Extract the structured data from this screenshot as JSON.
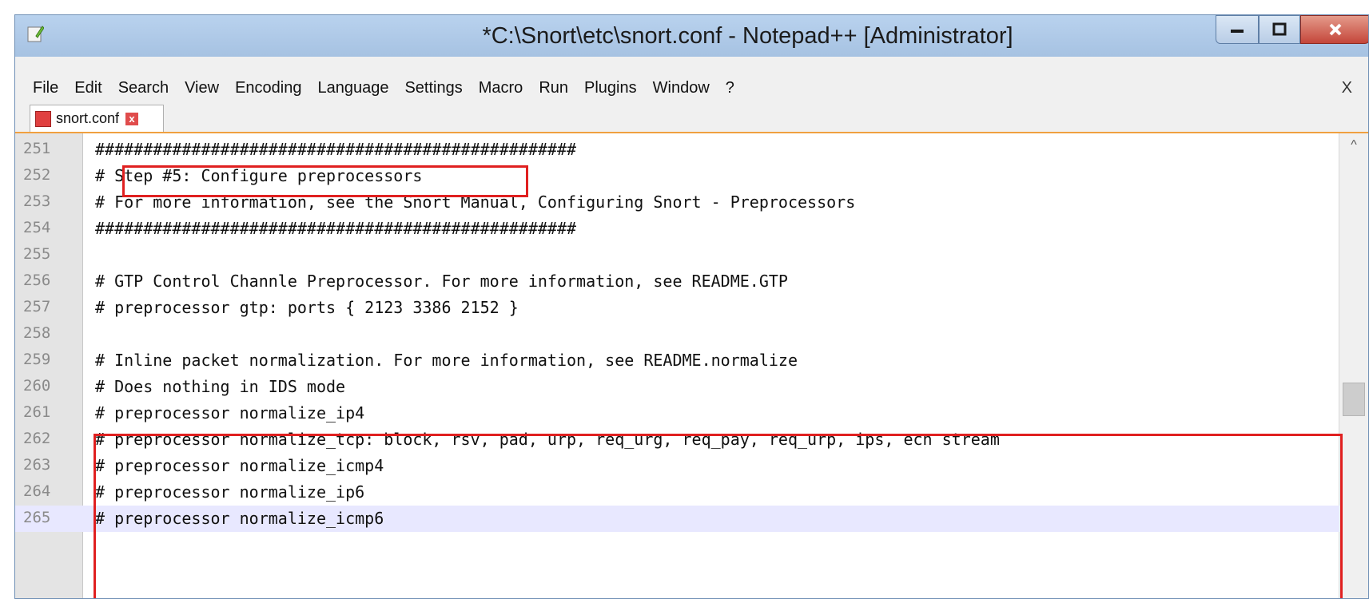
{
  "window": {
    "title": "*C:\\Snort\\etc\\snort.conf - Notepad++ [Administrator]",
    "min_glyph": "–",
    "max_glyph": "☐",
    "close_glyph": "x"
  },
  "menu": [
    "File",
    "Edit",
    "Search",
    "View",
    "Encoding",
    "Language",
    "Settings",
    "Macro",
    "Run",
    "Plugins",
    "Window",
    "?"
  ],
  "menu_close": "X",
  "toolbar_icons": [
    "new-file-icon",
    "open-file-icon",
    "save-icon",
    "save-all-icon",
    "close-icon",
    "close-all-icon",
    "print-icon",
    "sep",
    "cut-icon",
    "copy-icon",
    "paste-icon",
    "sep",
    "undo-icon",
    "redo-icon",
    "sep",
    "find-icon",
    "replace-icon",
    "sep",
    "zoom-in-icon",
    "zoom-out-icon",
    "sep",
    "sync-vertical-icon",
    "sync-horizontal-icon",
    "sep",
    "word-wrap-icon",
    "show-all-chars-icon",
    "indent-guide-icon",
    "doc-map-icon",
    "function-list-icon",
    "folder-icon",
    "sep",
    "record-macro-icon",
    "stop-record-icon",
    "play-macro-icon",
    "run-multiple-icon",
    "save-macro-icon",
    "sep",
    "spellcheck-icon",
    "npp-icon"
  ],
  "tab": {
    "label": "snort.conf",
    "close": "x"
  },
  "lines": [
    {
      "n": "251",
      "text": "##################################################"
    },
    {
      "n": "252",
      "text": "# Step #5: Configure preprocessors"
    },
    {
      "n": "253",
      "text": "# For more information, see the Snort Manual, Configuring Snort - Preprocessors"
    },
    {
      "n": "254",
      "text": "##################################################"
    },
    {
      "n": "255",
      "text": ""
    },
    {
      "n": "256",
      "text": "# GTP Control Channle Preprocessor. For more information, see README.GTP"
    },
    {
      "n": "257",
      "text": "# preprocessor gtp: ports { 2123 3386 2152 }"
    },
    {
      "n": "258",
      "text": ""
    },
    {
      "n": "259",
      "text": "# Inline packet normalization. For more information, see README.normalize"
    },
    {
      "n": "260",
      "text": "# Does nothing in IDS mode"
    },
    {
      "n": "261",
      "text": "# preprocessor normalize_ip4"
    },
    {
      "n": "262",
      "text": "# preprocessor normalize_tcp: block, rsv, pad, urp, req_urg, req_pay, req_urp, ips, ecn stream"
    },
    {
      "n": "263",
      "text": "# preprocessor normalize_icmp4"
    },
    {
      "n": "264",
      "text": "# preprocessor normalize_ip6"
    },
    {
      "n": "265",
      "text": "# preprocessor normalize_icmp6"
    }
  ],
  "scroll_up": "^",
  "colors": {
    "highlight_box": "#e02020",
    "current_line": "#e8e8ff",
    "tab_accent": "#f0a040"
  }
}
